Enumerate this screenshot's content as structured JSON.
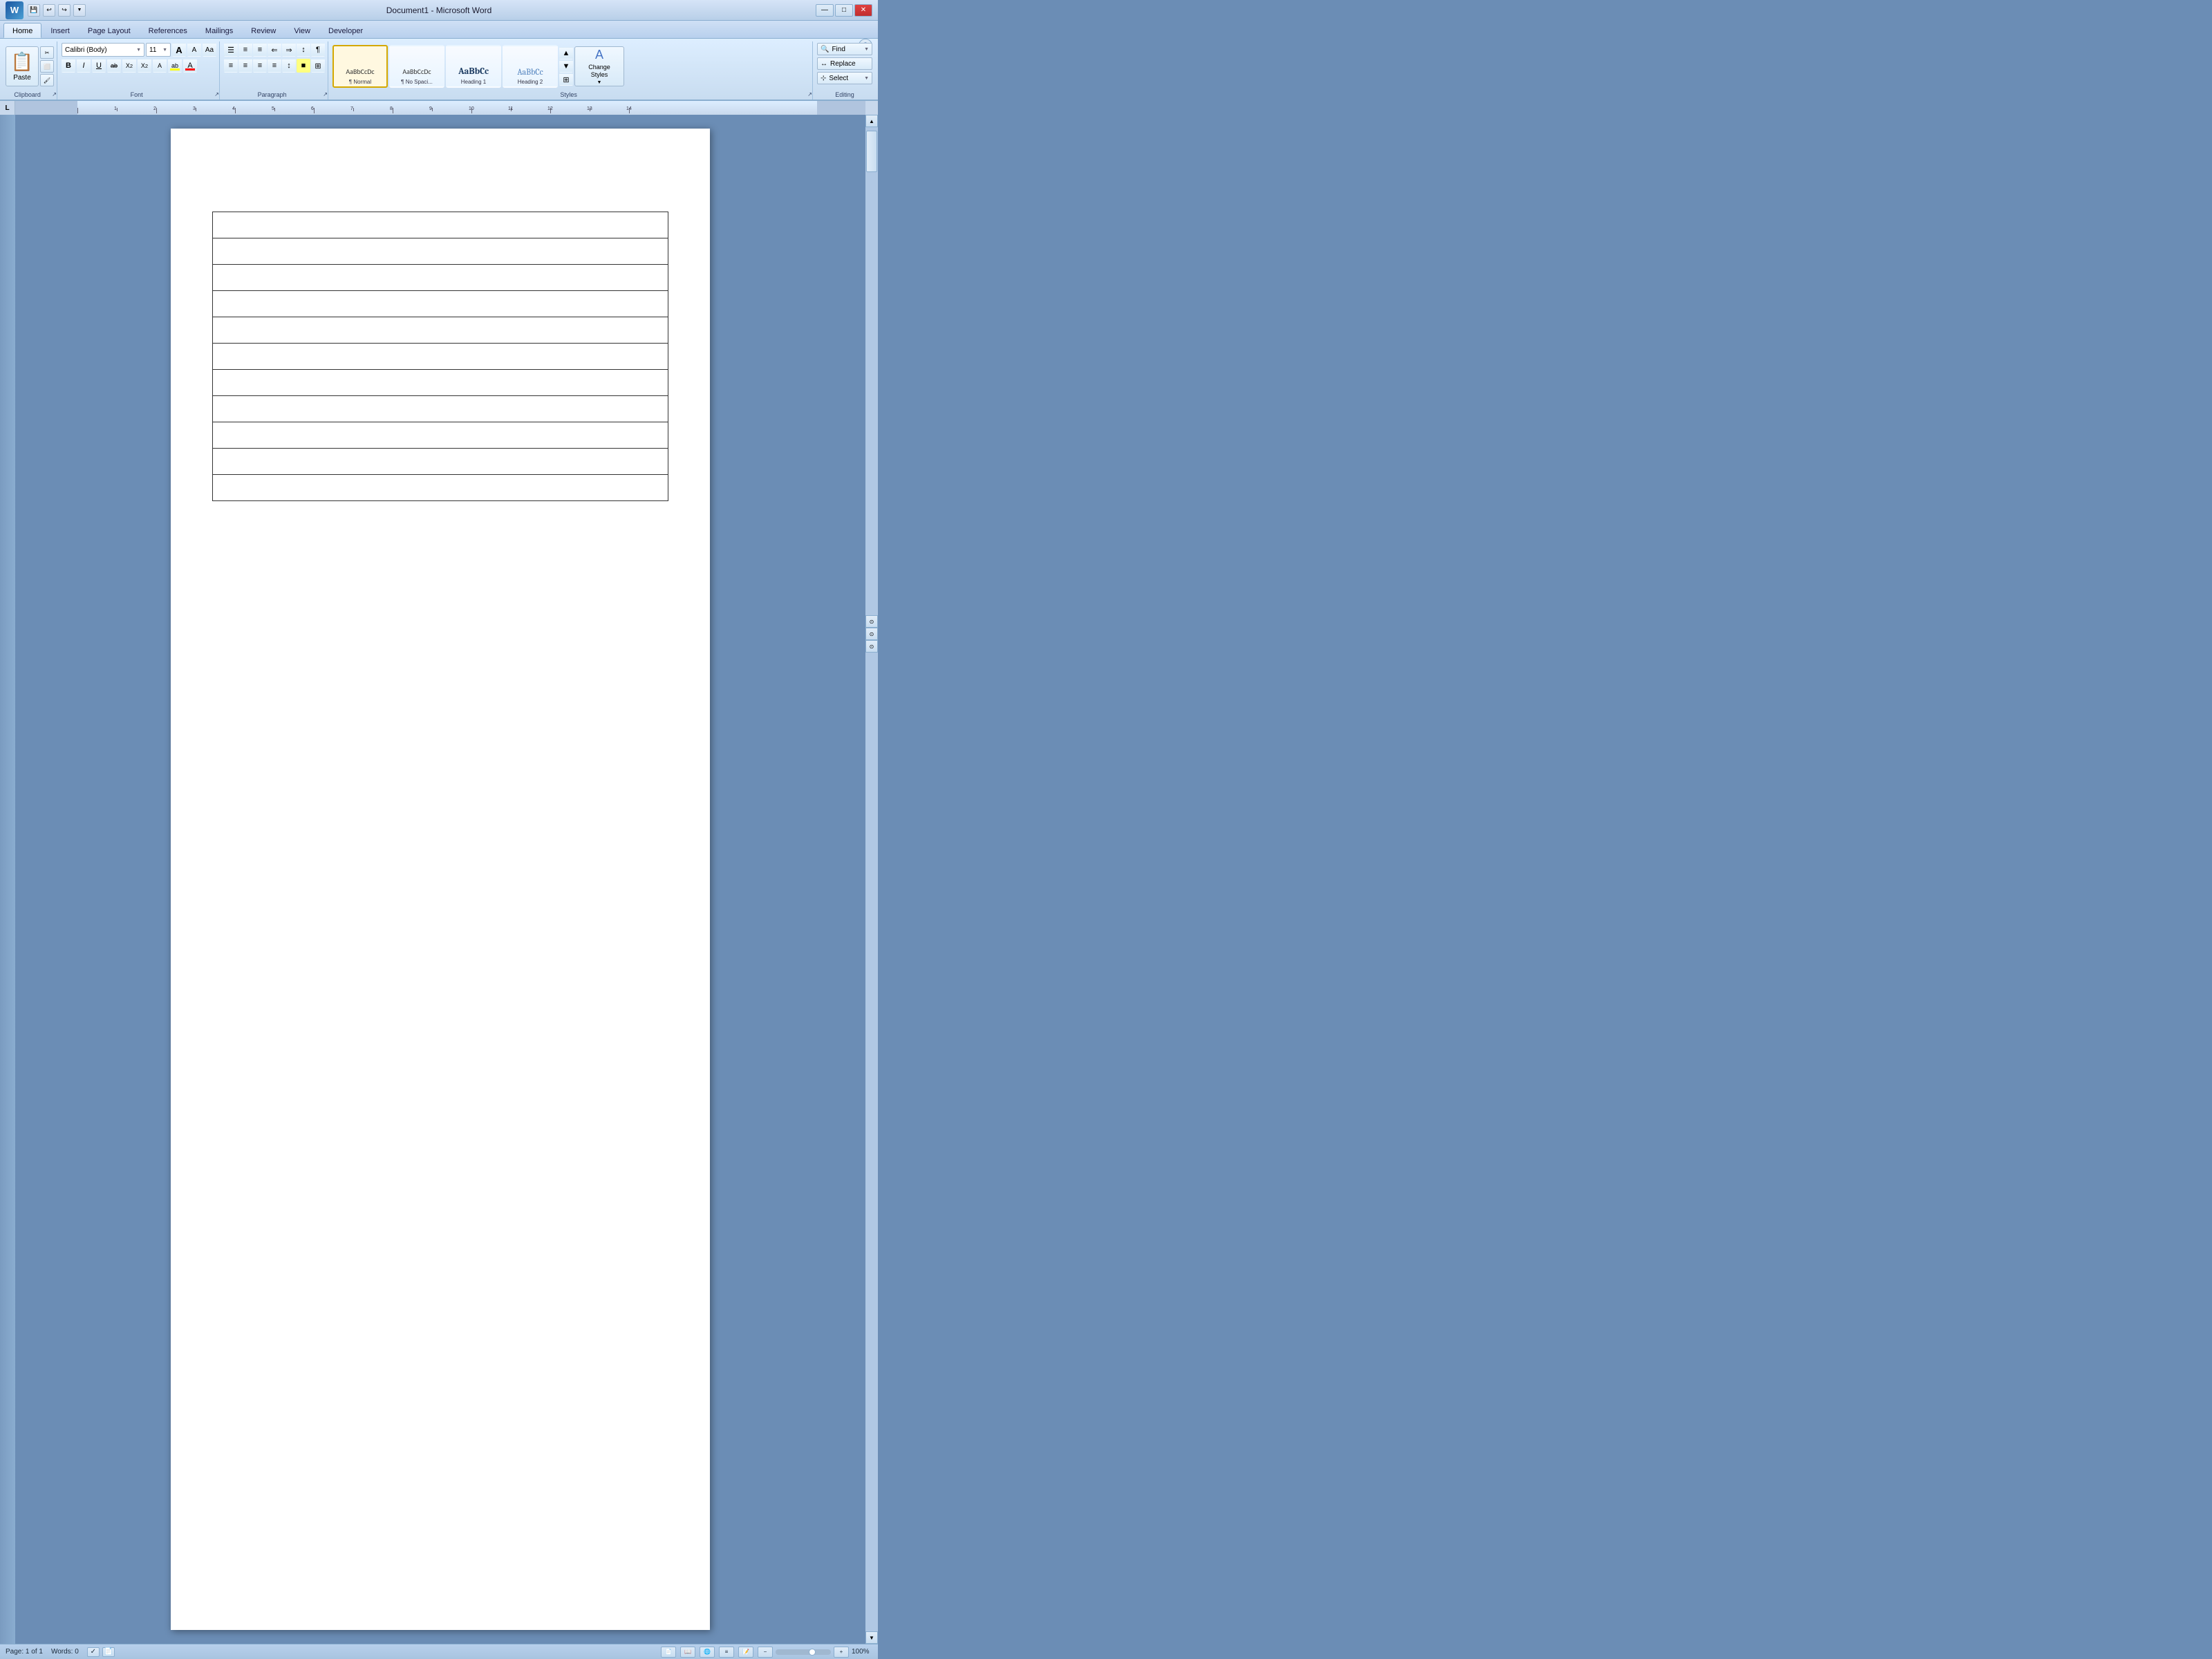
{
  "titlebar": {
    "title": "Document1 - Microsoft Word",
    "app_icon": "W",
    "minimize": "—",
    "maximize": "□",
    "close": "✕"
  },
  "tabs": {
    "items": [
      "Home",
      "Insert",
      "Page Layout",
      "References",
      "Mailings",
      "Review",
      "View",
      "Developer"
    ],
    "active": "Home"
  },
  "ribbon": {
    "groups": {
      "clipboard": {
        "label": "Clipboard",
        "paste": "Paste",
        "cut": "✂",
        "copy": "⬜",
        "format_painter": "🖌"
      },
      "font": {
        "label": "Font",
        "font_name": "Calibri (Body)",
        "font_size": "11",
        "grow": "A",
        "shrink": "A",
        "clear": "Aa",
        "bold": "B",
        "italic": "I",
        "underline": "U",
        "strikethrough": "ab",
        "subscript": "X₂",
        "superscript": "X²",
        "change_case": "Aa",
        "highlight": "ab",
        "font_color": "A"
      },
      "paragraph": {
        "label": "Paragraph",
        "bullets": "≡",
        "numbering": "≡",
        "multilevel": "≡",
        "decrease_indent": "⇐",
        "increase_indent": "⇒",
        "sort": "↕",
        "show_para": "¶",
        "align_left": "≡",
        "align_center": "≡",
        "align_right": "≡",
        "justify": "≡",
        "line_spacing": "↕",
        "shading": "■",
        "borders": "⊞"
      },
      "styles": {
        "label": "Styles",
        "items": [
          {
            "name": "Normal",
            "label": "¶ Normal",
            "active": true
          },
          {
            "name": "No Spacing",
            "label": "¶ No Spaci..."
          },
          {
            "name": "Heading 1",
            "label": "AaBbCc"
          },
          {
            "name": "Heading 2",
            "label": "AaBbCc"
          }
        ],
        "change_styles": "Change\nStyles"
      },
      "editing": {
        "label": "Editing",
        "find": "Find",
        "replace": "Replace",
        "select": "Select"
      }
    }
  },
  "ruler": {
    "indicator": "L"
  },
  "document": {
    "table_rows": 11,
    "table_cols": 1
  },
  "statusbar": {
    "page": "Page: 1 of 1",
    "words": "Words: 0",
    "zoom": "100%",
    "zoom_value": 100
  }
}
